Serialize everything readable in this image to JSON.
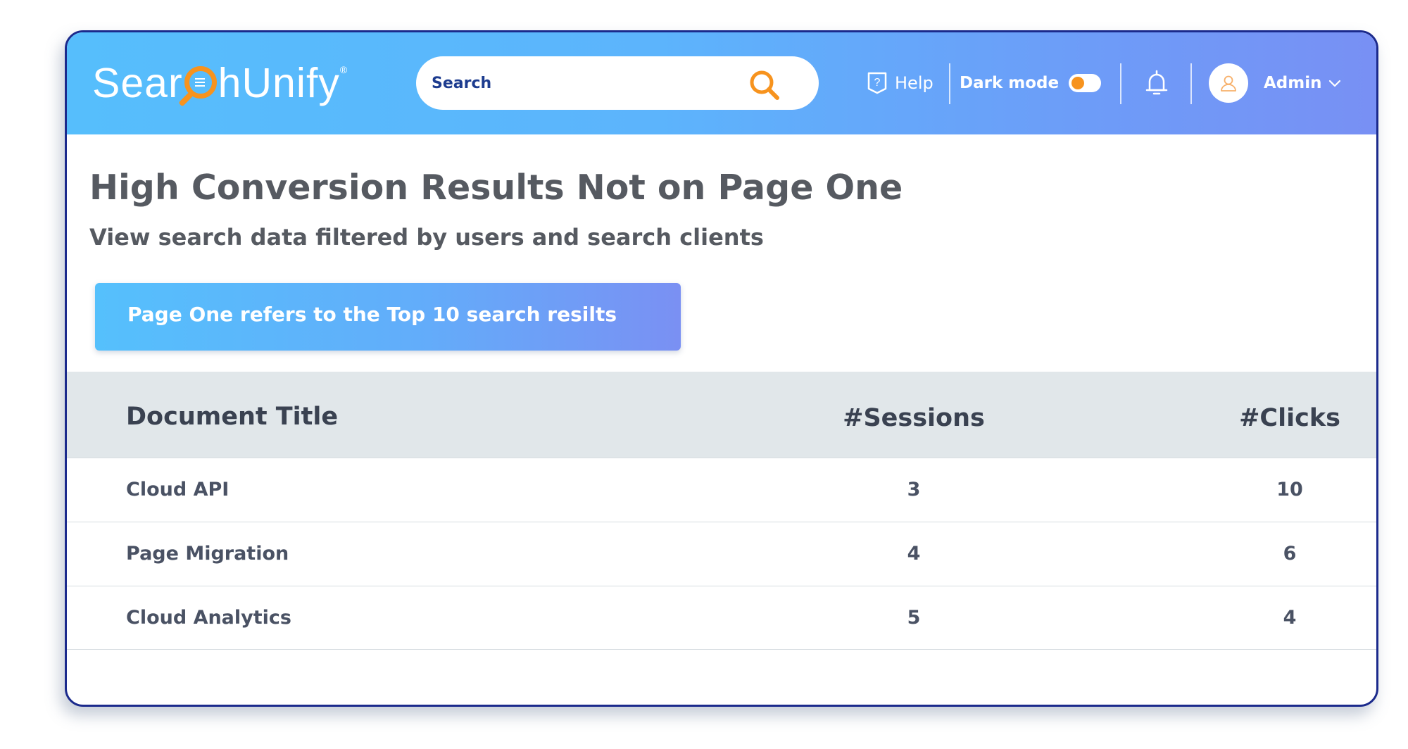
{
  "header": {
    "logo_text_before": "Sear",
    "logo_text_after": "hUnify",
    "logo_mark": "®",
    "search": {
      "value": "",
      "placeholder": "Search"
    },
    "help_label": "Help",
    "dark_mode_label": "Dark mode",
    "dark_mode_enabled": false,
    "user_label": "Admin",
    "icons": [
      "search-icon",
      "help-icon",
      "toggle-switch",
      "bell-icon",
      "user-icon",
      "chevron-down-icon"
    ],
    "accent_color": "#f7931e",
    "gradient_colors": [
      "#56befc",
      "#7890f4"
    ]
  },
  "main": {
    "title": "High Conversion Results Not on Page One",
    "subtitle": "View search data filtered by users and search clients",
    "info_banner": "Page One refers to the Top 10 search resilts"
  },
  "table": {
    "columns": [
      "Document Title",
      "#Sessions",
      "#Clicks"
    ],
    "rows": [
      {
        "title": "Cloud API",
        "sessions": "3",
        "clicks": "10"
      },
      {
        "title": "Page Migration",
        "sessions": "4",
        "clicks": "6"
      },
      {
        "title": "Cloud Analytics",
        "sessions": "5",
        "clicks": "4"
      }
    ]
  }
}
